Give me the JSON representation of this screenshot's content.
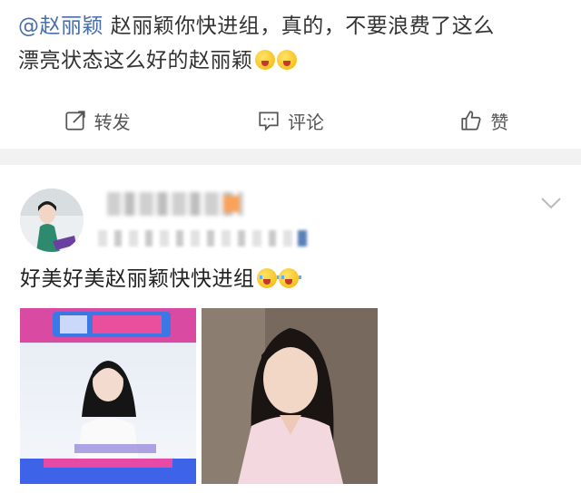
{
  "post1": {
    "mention": "@赵丽颖",
    "text_line1": " 赵丽颖你快进组，真的，不要浪费了这么",
    "text_line2": "漂亮状态这么好的赵丽颖"
  },
  "actions": {
    "repost_label": "转发",
    "comment_label": "评论",
    "like_label": "赞"
  },
  "post2": {
    "text": "好美好美赵丽颖快快进组"
  },
  "colors": {
    "mention": "#4a6ea9",
    "divider": "#f2f2f2",
    "text": "#222222"
  }
}
